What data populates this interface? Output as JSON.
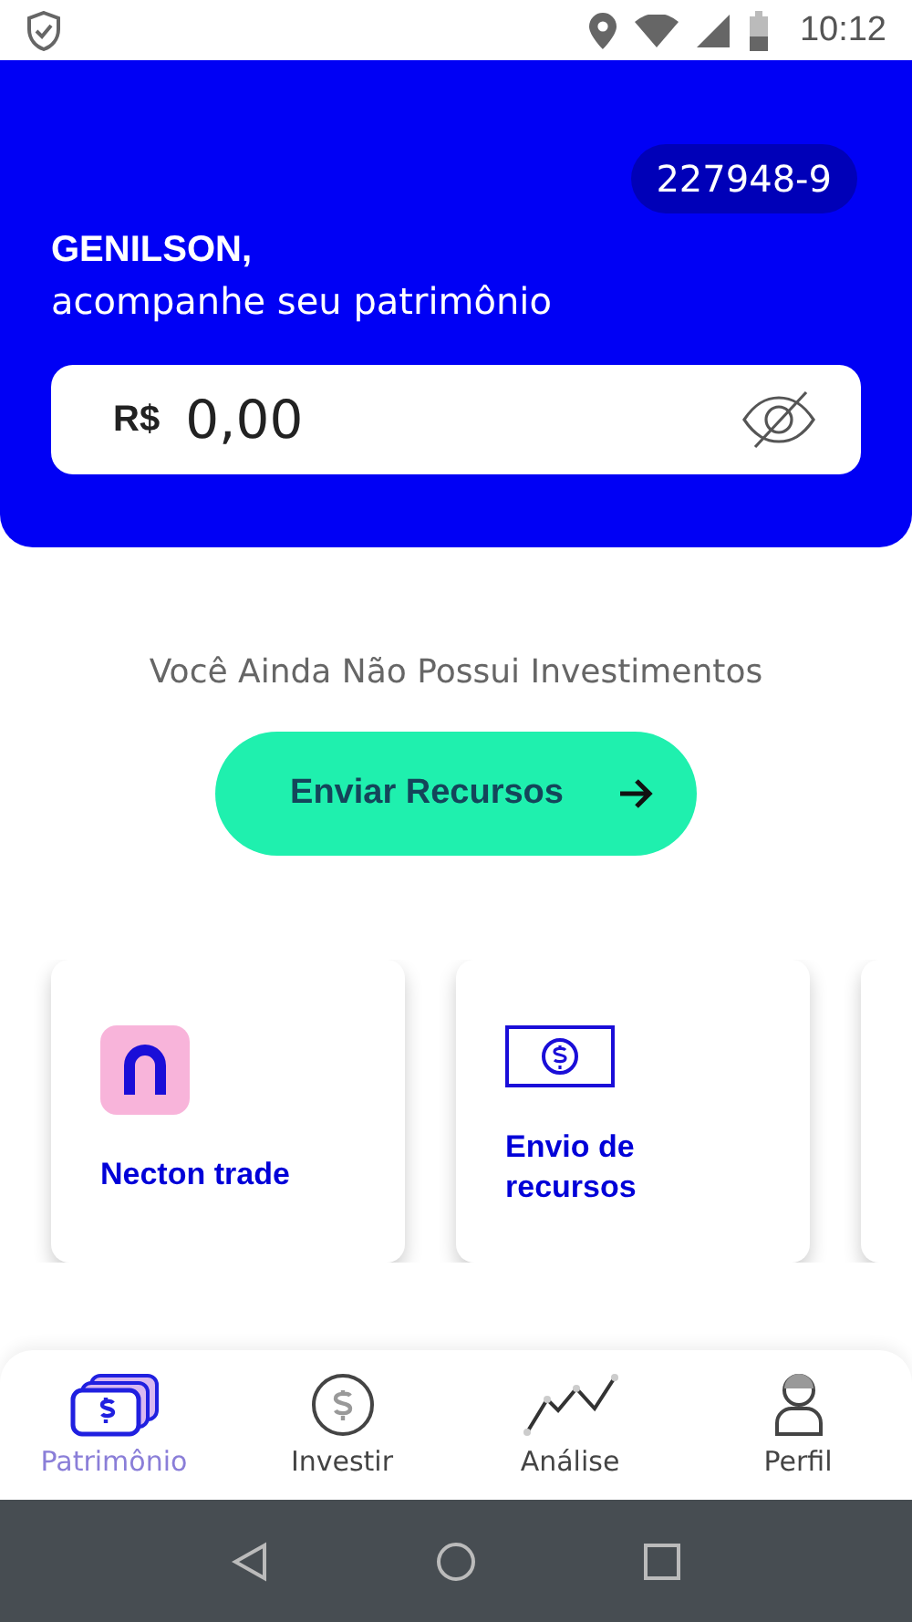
{
  "status_bar": {
    "time": "10:12"
  },
  "header": {
    "account": "227948-9",
    "name": "GENILSON,",
    "subtitle": "acompanhe seu patrimônio",
    "balance": {
      "currency": "R$",
      "value": "0,00"
    }
  },
  "empty_message": "Você Ainda Não Possui Investimentos",
  "action_button": {
    "label": "Enviar Recursos"
  },
  "cards": [
    {
      "kind": "logo",
      "label": "Necton trade"
    },
    {
      "kind": "money",
      "label": "Envio de recursos"
    },
    {
      "kind": "partial"
    }
  ],
  "bottom_nav": [
    {
      "kind": "wallet",
      "label": "Patrimônio",
      "selected": true
    },
    {
      "kind": "coin",
      "label": "Investir",
      "selected": false
    },
    {
      "kind": "chart",
      "label": "Análise",
      "selected": false
    },
    {
      "kind": "person",
      "label": "Perfil",
      "selected": false
    }
  ]
}
